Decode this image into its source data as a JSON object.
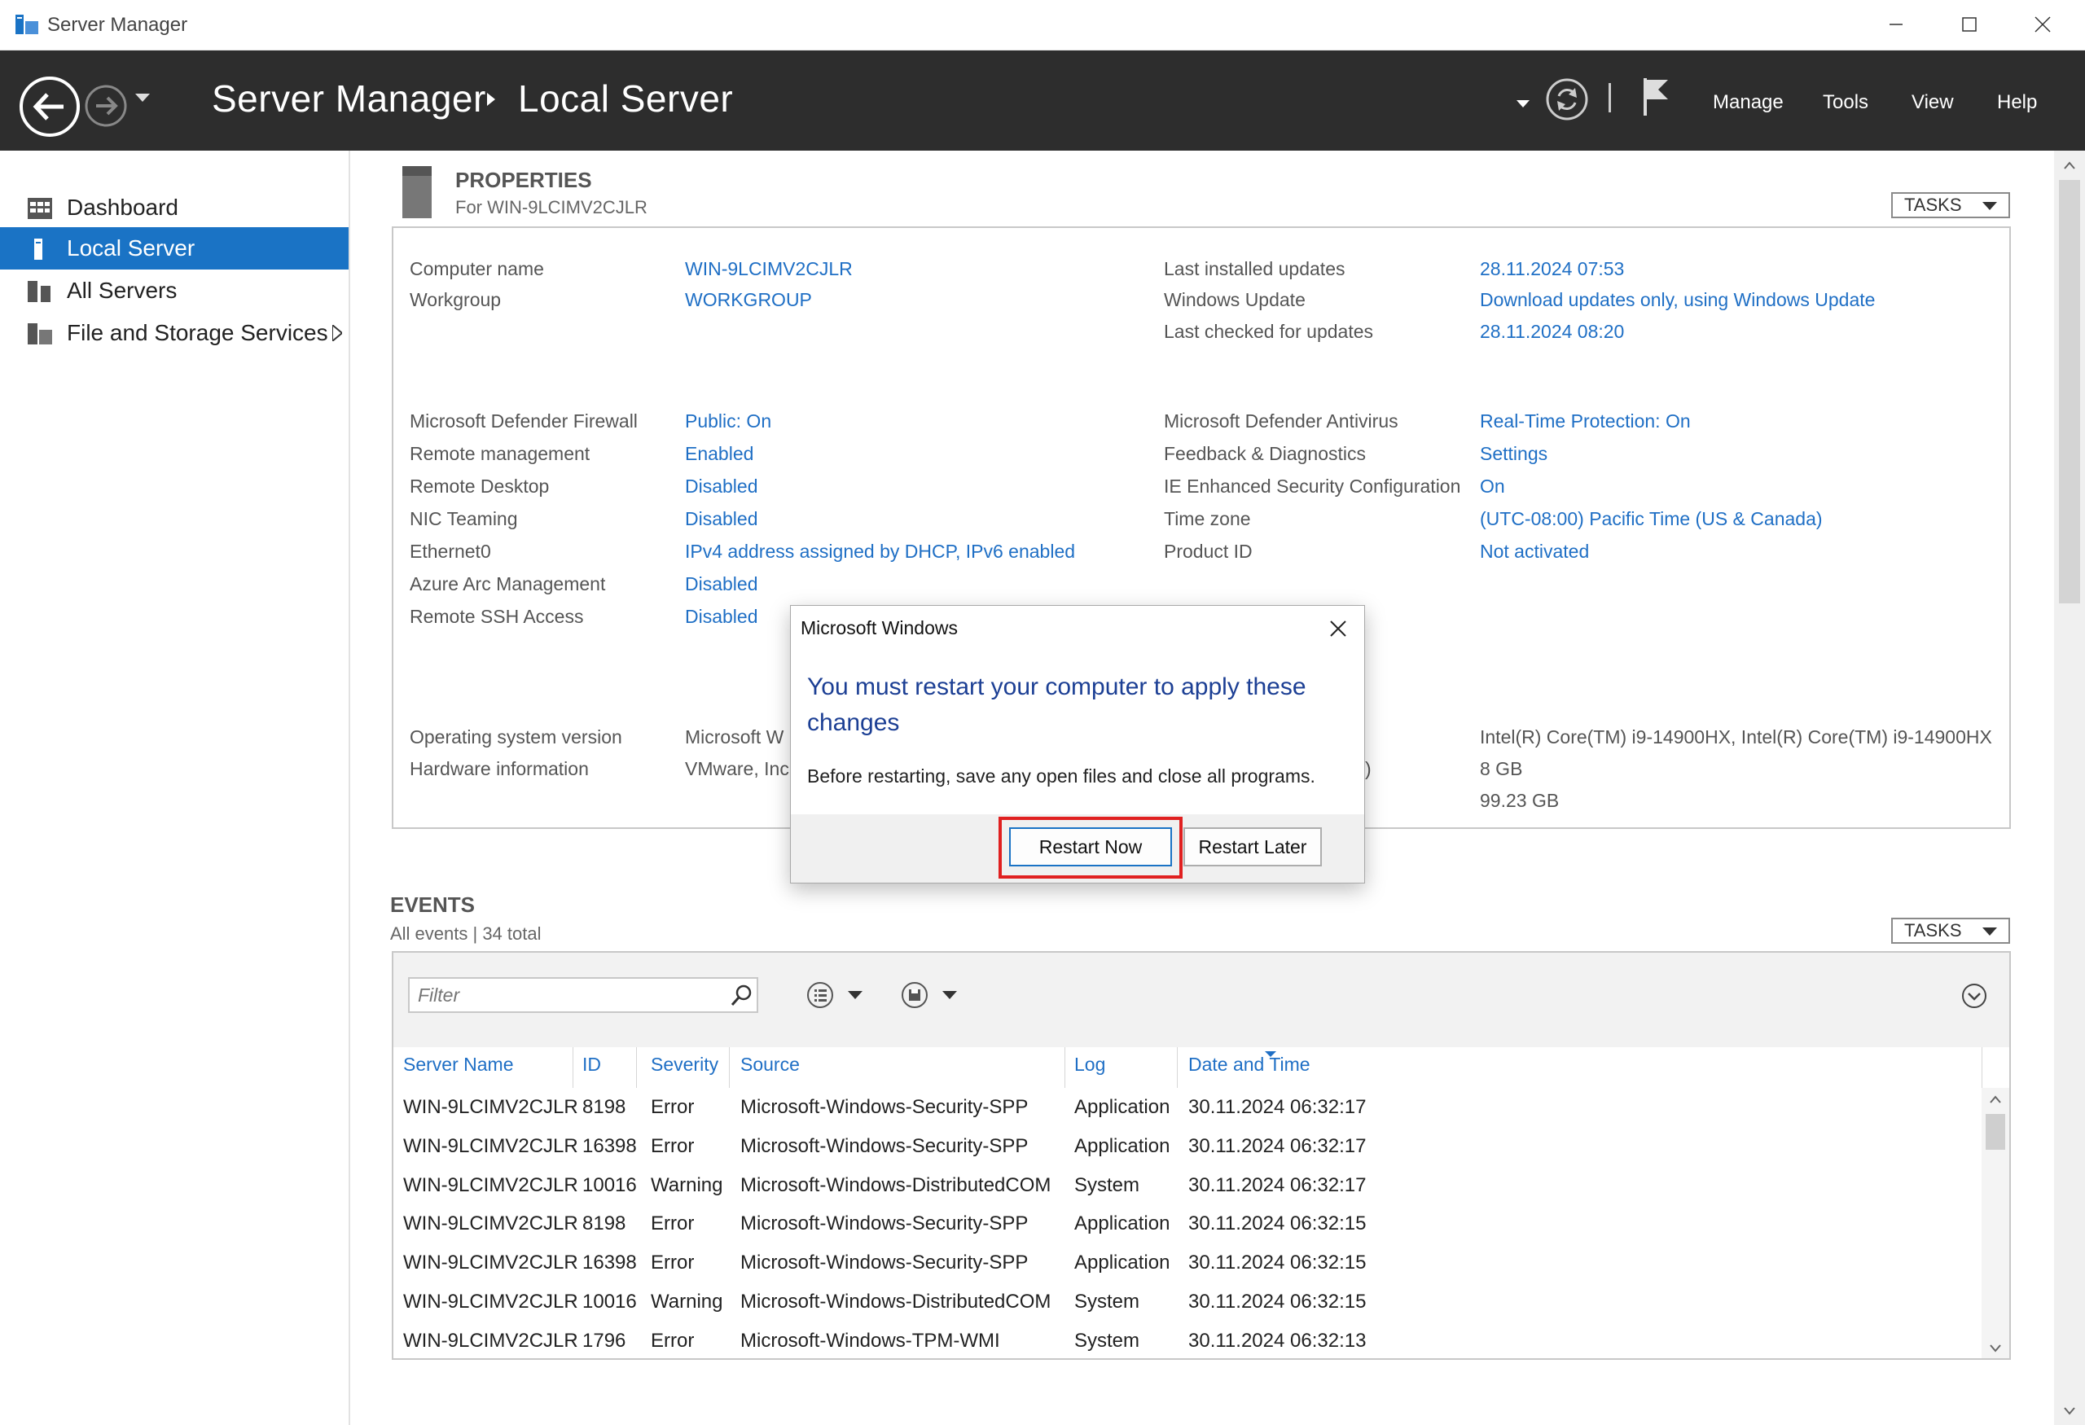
{
  "window": {
    "title": "Server Manager"
  },
  "header": {
    "breadcrumb_root": "Server Manager",
    "breadcrumb_current": "Local Server",
    "menu": [
      "Manage",
      "Tools",
      "View",
      "Help"
    ]
  },
  "sidebar": {
    "items": [
      {
        "label": "Dashboard",
        "icon": "dashboard-icon"
      },
      {
        "label": "Local Server",
        "icon": "server-icon",
        "active": true
      },
      {
        "label": "All Servers",
        "icon": "servers-icon"
      },
      {
        "label": "File and Storage Services",
        "icon": "storage-icon"
      }
    ]
  },
  "properties": {
    "title": "PROPERTIES",
    "subtitle": "For WIN-9LCIMV2CJLR",
    "tasks_label": "TASKS",
    "left": [
      {
        "label": "Computer name",
        "value": "WIN-9LCIMV2CJLR"
      },
      {
        "label": "Workgroup",
        "value": "WORKGROUP"
      },
      {
        "label": "Microsoft Defender Firewall",
        "value": "Public: On"
      },
      {
        "label": "Remote management",
        "value": "Enabled"
      },
      {
        "label": "Remote Desktop",
        "value": "Disabled"
      },
      {
        "label": "NIC Teaming",
        "value": "Disabled"
      },
      {
        "label": "Ethernet0",
        "value": "IPv4 address assigned by DHCP, IPv6 enabled"
      },
      {
        "label": "Azure Arc Management",
        "value": "Disabled"
      },
      {
        "label": "Remote SSH Access",
        "value": "Disabled"
      },
      {
        "label": "Operating system version",
        "value": "Microsoft W"
      },
      {
        "label": "Hardware information",
        "value": "VMware, Inc"
      }
    ],
    "right": [
      {
        "label": "Last installed updates",
        "value": "28.11.2024 07:53"
      },
      {
        "label": "Windows Update",
        "value": "Download updates only, using Windows Update"
      },
      {
        "label": "Last checked for updates",
        "value": "28.11.2024 08:20"
      },
      {
        "label": "Microsoft Defender Antivirus",
        "value": "Real-Time Protection: On"
      },
      {
        "label": "Feedback & Diagnostics",
        "value": "Settings"
      },
      {
        "label": "IE Enhanced Security Configuration",
        "value": "On"
      },
      {
        "label": "Time zone",
        "value": "(UTC-08:00) Pacific Time (US & Canada)"
      },
      {
        "label": "Product ID",
        "value": "Not activated"
      }
    ],
    "hardware": {
      "processors": "Intel(R) Core(TM) i9-14900HX, Intel(R) Core(TM) i9-14900HX",
      "memory_partial": ")",
      "memory": "8 GB",
      "disk": "99.23 GB"
    }
  },
  "events": {
    "title": "EVENTS",
    "subtitle": "All events | 34 total",
    "tasks_label": "TASKS",
    "filter_placeholder": "Filter",
    "columns": [
      "Server Name",
      "ID",
      "Severity",
      "Source",
      "Log",
      "Date and Time"
    ],
    "rows": [
      [
        "WIN-9LCIMV2CJLR",
        "8198",
        "Error",
        "Microsoft-Windows-Security-SPP",
        "Application",
        "30.11.2024 06:32:17"
      ],
      [
        "WIN-9LCIMV2CJLR",
        "16398",
        "Error",
        "Microsoft-Windows-Security-SPP",
        "Application",
        "30.11.2024 06:32:17"
      ],
      [
        "WIN-9LCIMV2CJLR",
        "10016",
        "Warning",
        "Microsoft-Windows-DistributedCOM",
        "System",
        "30.11.2024 06:32:17"
      ],
      [
        "WIN-9LCIMV2CJLR",
        "8198",
        "Error",
        "Microsoft-Windows-Security-SPP",
        "Application",
        "30.11.2024 06:32:15"
      ],
      [
        "WIN-9LCIMV2CJLR",
        "16398",
        "Error",
        "Microsoft-Windows-Security-SPP",
        "Application",
        "30.11.2024 06:32:15"
      ],
      [
        "WIN-9LCIMV2CJLR",
        "10016",
        "Warning",
        "Microsoft-Windows-DistributedCOM",
        "System",
        "30.11.2024 06:32:15"
      ],
      [
        "WIN-9LCIMV2CJLR",
        "1796",
        "Error",
        "Microsoft-Windows-TPM-WMI",
        "System",
        "30.11.2024 06:32:13"
      ]
    ]
  },
  "dialog": {
    "title": "Microsoft Windows",
    "main_instruction": "You must restart your computer to apply these changes",
    "description": "Before restarting, save any open files and close all programs.",
    "restart_now": "Restart Now",
    "restart_later": "Restart Later"
  },
  "colors": {
    "header_bg": "#2d2d2d",
    "accent": "#1a73c5",
    "link": "#1f6fc5",
    "highlight": "#e02020"
  }
}
